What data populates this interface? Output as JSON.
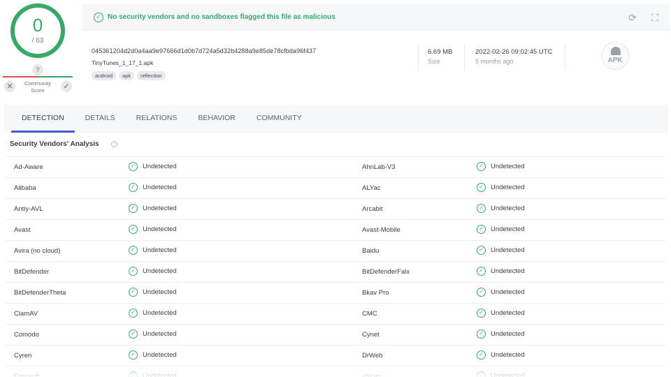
{
  "score": {
    "detections": "0",
    "total": "/ 63"
  },
  "community": {
    "question": "?",
    "label": "Community Score",
    "down": "✕",
    "up": "✓"
  },
  "banner": {
    "message": "No security vendors and no sandboxes flagged this file as malicious"
  },
  "file": {
    "hash": "045361204d2d0a4aa9e97666d1d0b7d724a5d32b4288a9e85de78cfbda96f437",
    "name": "TinyTunes_1_17_1.apk",
    "tags": [
      "android",
      "apk",
      "reflection"
    ],
    "size_value": "6.69 MB",
    "size_label": "Size",
    "date_value": "2022-02-26 09:02:45 UTC",
    "date_label": "5 months ago",
    "type_icon_label": "APK"
  },
  "tabs": [
    "DETECTION",
    "DETAILS",
    "RELATIONS",
    "BEHAVIOR",
    "COMMUNITY"
  ],
  "section": {
    "title": "Security Vendors' Analysis",
    "info": "i"
  },
  "colors": {
    "accent": "#3b61c9",
    "clean": "#39a66c",
    "malicious": "#e04a4a"
  },
  "vendors": [
    {
      "left": "Ad-Aware",
      "left_status": "Undetected",
      "right": "AhnLab-V3",
      "right_status": "Undetected"
    },
    {
      "left": "Alibaba",
      "left_status": "Undetected",
      "right": "ALYac",
      "right_status": "Undetected"
    },
    {
      "left": "Antiy-AVL",
      "left_status": "Undetected",
      "right": "Arcabit",
      "right_status": "Undetected"
    },
    {
      "left": "Avast",
      "left_status": "Undetected",
      "right": "Avast-Mobile",
      "right_status": "Undetected"
    },
    {
      "left": "Avira (no cloud)",
      "left_status": "Undetected",
      "right": "Baidu",
      "right_status": "Undetected"
    },
    {
      "left": "BitDefender",
      "left_status": "Undetected",
      "right": "BitDefenderFalx",
      "right_status": "Undetected"
    },
    {
      "left": "BitDefenderTheta",
      "left_status": "Undetected",
      "right": "Bkav Pro",
      "right_status": "Undetected"
    },
    {
      "left": "ClamAV",
      "left_status": "Undetected",
      "right": "CMC",
      "right_status": "Undetected"
    },
    {
      "left": "Comodo",
      "left_status": "Undetected",
      "right": "Cynet",
      "right_status": "Undetected"
    },
    {
      "left": "Cyren",
      "left_status": "Undetected",
      "right": "DrWeb",
      "right_status": "Undetected"
    },
    {
      "left": "Emsisoft",
      "left_status": "Undetected",
      "right": "eScan",
      "right_status": "Undetected"
    }
  ]
}
